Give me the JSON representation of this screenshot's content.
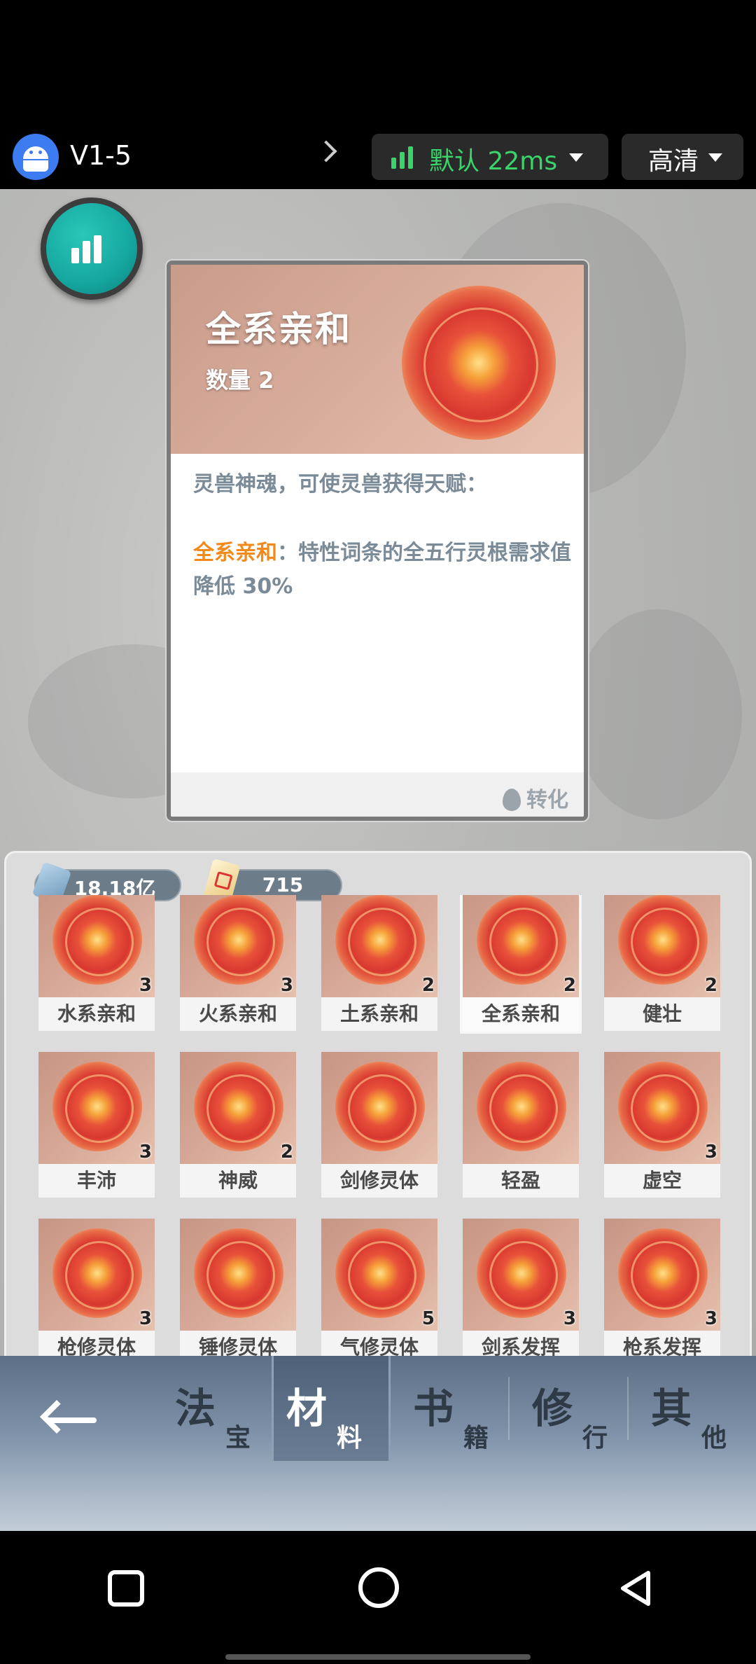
{
  "topbar": {
    "version": "V1-5",
    "network_label": "默认 22ms",
    "quality_label": "高清",
    "network_color": "#3bd46a"
  },
  "detail": {
    "title": "全系亲和",
    "quantity": "数量 2",
    "description": "灵兽神魂，可使灵兽获得天赋：",
    "effect_name": "全系亲和",
    "effect_text": "：特性词条的全五行灵根需求值降低 30%",
    "convert_label": "转化",
    "highlight_color": "#f08a1c"
  },
  "currency": {
    "spirit_stones": "18.18亿",
    "scrolls": "715"
  },
  "items": [
    {
      "name": "水系亲和",
      "count": "3"
    },
    {
      "name": "火系亲和",
      "count": "3"
    },
    {
      "name": "土系亲和",
      "count": "2"
    },
    {
      "name": "全系亲和",
      "count": "2",
      "selected": true
    },
    {
      "name": "健壮",
      "count": "2"
    },
    {
      "name": "丰沛",
      "count": "3"
    },
    {
      "name": "神威",
      "count": "2"
    },
    {
      "name": "剑修灵体",
      "count": ""
    },
    {
      "name": "轻盈",
      "count": ""
    },
    {
      "name": "虚空",
      "count": "3"
    },
    {
      "name": "枪修灵体",
      "count": "3"
    },
    {
      "name": "锤修灵体",
      "count": ""
    },
    {
      "name": "气修灵体",
      "count": "5"
    },
    {
      "name": "剑系发挥",
      "count": "3"
    },
    {
      "name": "枪系发挥",
      "count": "3"
    }
  ],
  "tabs": [
    {
      "big": "法",
      "small": "宝"
    },
    {
      "big": "材",
      "small": "料",
      "active": true
    },
    {
      "big": "书",
      "small": "籍"
    },
    {
      "big": "修",
      "small": "行"
    },
    {
      "big": "其",
      "small": "他"
    }
  ]
}
